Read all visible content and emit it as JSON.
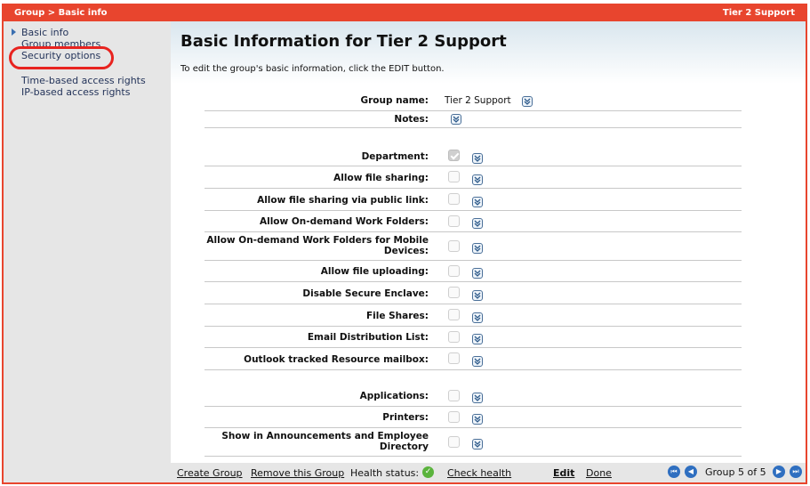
{
  "titlebar": {
    "breadcrumb": "Group > Basic info",
    "right_title": "Tier 2 Support"
  },
  "sidebar": {
    "items": [
      {
        "label": "Basic info"
      },
      {
        "label": "Group members"
      },
      {
        "label": "Security options"
      },
      {
        "label": "Time-based access rights"
      },
      {
        "label": "IP-based access rights"
      }
    ]
  },
  "main": {
    "title": "Basic Information for Tier 2 Support",
    "intro": "To edit the group's basic information, click the EDIT button.",
    "group_name_label": "Group name:",
    "group_name_value": "Tier 2 Support",
    "notes_label": "Notes:",
    "fields": [
      {
        "label": "Department:",
        "checked": true
      },
      {
        "label": "Allow file sharing:",
        "checked": false
      },
      {
        "label": "Allow file sharing via public link:",
        "checked": false
      },
      {
        "label": "Allow On-demand Work Folders:",
        "checked": false
      },
      {
        "label": "Allow On-demand Work Folders for Mobile Devices:",
        "checked": false
      },
      {
        "label": "Allow file uploading:",
        "checked": false
      },
      {
        "label": "Disable Secure Enclave:",
        "checked": false
      },
      {
        "label": "File Shares:",
        "checked": false
      },
      {
        "label": "Email Distribution List:",
        "checked": false
      },
      {
        "label": "Outlook tracked Resource mailbox:",
        "checked": false
      },
      {
        "label": "Applications:",
        "checked": false
      },
      {
        "label": "Printers:",
        "checked": false
      },
      {
        "label": "Show in Announcements and Employee Directory",
        "checked": false
      }
    ]
  },
  "footer": {
    "create_group": "Create Group",
    "remove_group": "Remove this Group",
    "health_status_label": "Health status:",
    "check_health": "Check health",
    "edit": "Edit",
    "done": "Done",
    "pager": "Group 5 of 5"
  },
  "colors": {
    "accent": "#e8452e",
    "sidebar_bg": "#e6e6e6",
    "link": "#24345a",
    "nav_button": "#2f6fc0",
    "health_ok": "#5ab33c"
  }
}
